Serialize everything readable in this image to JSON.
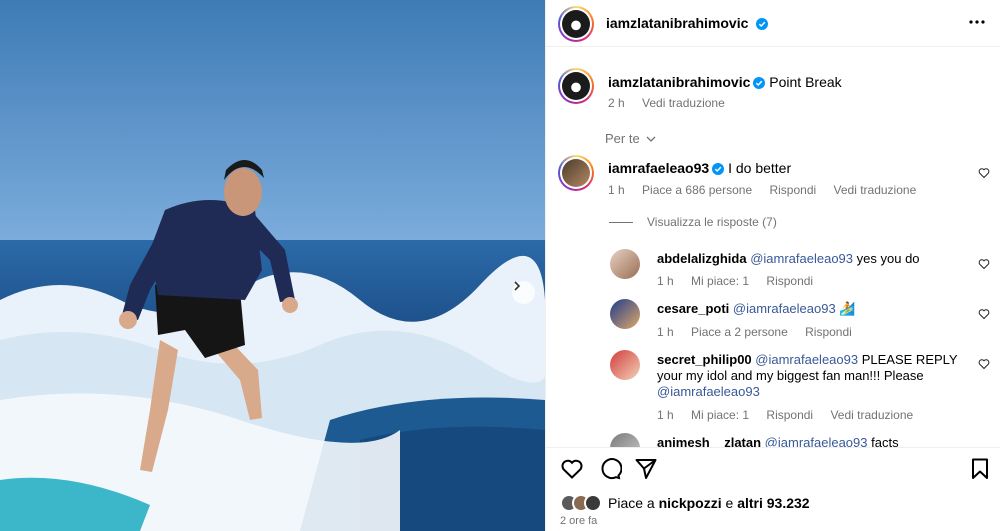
{
  "post": {
    "author": "iamzlatanibrahimovic",
    "caption": "Point Break",
    "time": "2 h",
    "translate": "Vedi traduzione",
    "for_you": "Per te",
    "ago": "2 ore fa"
  },
  "likes": {
    "prefix": "Piace a",
    "user": "nickpozzi",
    "connector": "e",
    "others": "altri 93.232"
  },
  "comments": [
    {
      "user": "iamrafaeleao93",
      "text": "I do better",
      "time": "1 h",
      "likes": "Piace a 686 persone",
      "reply": "Rispondi",
      "translate": "Vedi traduzione",
      "view_replies": "Visualizza le risposte (7)"
    }
  ],
  "replies": [
    {
      "user": "abdelalizghida",
      "mention": "@iamrafaeleao93",
      "text": "yes you do",
      "time": "1 h",
      "likes": "Mi piace: 1",
      "reply": "Rispondi"
    },
    {
      "user": "cesare_poti",
      "mention": "@iamrafaeleao93",
      "text": "🏄",
      "time": "1 h",
      "likes": "Piace a 2 persone",
      "reply": "Rispondi"
    },
    {
      "user": "secret_philip00",
      "mention": "@iamrafaeleao93",
      "text": "PLEASE REPLY your my idol and my biggest fan man!!! Please",
      "mention2": "@iamrafaeleao93",
      "time": "1 h",
      "likes": "Mi piace: 1",
      "reply": "Rispondi",
      "translate": "Vedi traduzione"
    },
    {
      "user": "animesh__zlatan",
      "mention": "@iamrafaeleao93",
      "text": "facts"
    }
  ],
  "colors": {
    "verified": "#0095f6",
    "mention": "#385898",
    "muted": "#737373"
  },
  "icons": [
    "more-icon",
    "verified-icon",
    "heart-icon",
    "comment-icon",
    "share-icon",
    "bookmark-icon",
    "chevron-right-icon",
    "chevron-down-icon"
  ]
}
